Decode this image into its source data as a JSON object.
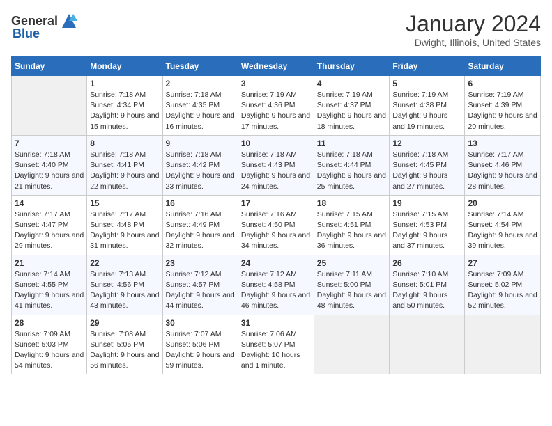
{
  "header": {
    "logo_general": "General",
    "logo_blue": "Blue",
    "title": "January 2024",
    "subtitle": "Dwight, Illinois, United States"
  },
  "days_of_week": [
    "Sunday",
    "Monday",
    "Tuesday",
    "Wednesday",
    "Thursday",
    "Friday",
    "Saturday"
  ],
  "weeks": [
    [
      {
        "day": "",
        "sunrise": "",
        "sunset": "",
        "daylight": ""
      },
      {
        "day": "1",
        "sunrise": "Sunrise: 7:18 AM",
        "sunset": "Sunset: 4:34 PM",
        "daylight": "Daylight: 9 hours and 15 minutes."
      },
      {
        "day": "2",
        "sunrise": "Sunrise: 7:18 AM",
        "sunset": "Sunset: 4:35 PM",
        "daylight": "Daylight: 9 hours and 16 minutes."
      },
      {
        "day": "3",
        "sunrise": "Sunrise: 7:19 AM",
        "sunset": "Sunset: 4:36 PM",
        "daylight": "Daylight: 9 hours and 17 minutes."
      },
      {
        "day": "4",
        "sunrise": "Sunrise: 7:19 AM",
        "sunset": "Sunset: 4:37 PM",
        "daylight": "Daylight: 9 hours and 18 minutes."
      },
      {
        "day": "5",
        "sunrise": "Sunrise: 7:19 AM",
        "sunset": "Sunset: 4:38 PM",
        "daylight": "Daylight: 9 hours and 19 minutes."
      },
      {
        "day": "6",
        "sunrise": "Sunrise: 7:19 AM",
        "sunset": "Sunset: 4:39 PM",
        "daylight": "Daylight: 9 hours and 20 minutes."
      }
    ],
    [
      {
        "day": "7",
        "sunrise": "Sunrise: 7:18 AM",
        "sunset": "Sunset: 4:40 PM",
        "daylight": "Daylight: 9 hours and 21 minutes."
      },
      {
        "day": "8",
        "sunrise": "Sunrise: 7:18 AM",
        "sunset": "Sunset: 4:41 PM",
        "daylight": "Daylight: 9 hours and 22 minutes."
      },
      {
        "day": "9",
        "sunrise": "Sunrise: 7:18 AM",
        "sunset": "Sunset: 4:42 PM",
        "daylight": "Daylight: 9 hours and 23 minutes."
      },
      {
        "day": "10",
        "sunrise": "Sunrise: 7:18 AM",
        "sunset": "Sunset: 4:43 PM",
        "daylight": "Daylight: 9 hours and 24 minutes."
      },
      {
        "day": "11",
        "sunrise": "Sunrise: 7:18 AM",
        "sunset": "Sunset: 4:44 PM",
        "daylight": "Daylight: 9 hours and 25 minutes."
      },
      {
        "day": "12",
        "sunrise": "Sunrise: 7:18 AM",
        "sunset": "Sunset: 4:45 PM",
        "daylight": "Daylight: 9 hours and 27 minutes."
      },
      {
        "day": "13",
        "sunrise": "Sunrise: 7:17 AM",
        "sunset": "Sunset: 4:46 PM",
        "daylight": "Daylight: 9 hours and 28 minutes."
      }
    ],
    [
      {
        "day": "14",
        "sunrise": "Sunrise: 7:17 AM",
        "sunset": "Sunset: 4:47 PM",
        "daylight": "Daylight: 9 hours and 29 minutes."
      },
      {
        "day": "15",
        "sunrise": "Sunrise: 7:17 AM",
        "sunset": "Sunset: 4:48 PM",
        "daylight": "Daylight: 9 hours and 31 minutes."
      },
      {
        "day": "16",
        "sunrise": "Sunrise: 7:16 AM",
        "sunset": "Sunset: 4:49 PM",
        "daylight": "Daylight: 9 hours and 32 minutes."
      },
      {
        "day": "17",
        "sunrise": "Sunrise: 7:16 AM",
        "sunset": "Sunset: 4:50 PM",
        "daylight": "Daylight: 9 hours and 34 minutes."
      },
      {
        "day": "18",
        "sunrise": "Sunrise: 7:15 AM",
        "sunset": "Sunset: 4:51 PM",
        "daylight": "Daylight: 9 hours and 36 minutes."
      },
      {
        "day": "19",
        "sunrise": "Sunrise: 7:15 AM",
        "sunset": "Sunset: 4:53 PM",
        "daylight": "Daylight: 9 hours and 37 minutes."
      },
      {
        "day": "20",
        "sunrise": "Sunrise: 7:14 AM",
        "sunset": "Sunset: 4:54 PM",
        "daylight": "Daylight: 9 hours and 39 minutes."
      }
    ],
    [
      {
        "day": "21",
        "sunrise": "Sunrise: 7:14 AM",
        "sunset": "Sunset: 4:55 PM",
        "daylight": "Daylight: 9 hours and 41 minutes."
      },
      {
        "day": "22",
        "sunrise": "Sunrise: 7:13 AM",
        "sunset": "Sunset: 4:56 PM",
        "daylight": "Daylight: 9 hours and 43 minutes."
      },
      {
        "day": "23",
        "sunrise": "Sunrise: 7:12 AM",
        "sunset": "Sunset: 4:57 PM",
        "daylight": "Daylight: 9 hours and 44 minutes."
      },
      {
        "day": "24",
        "sunrise": "Sunrise: 7:12 AM",
        "sunset": "Sunset: 4:58 PM",
        "daylight": "Daylight: 9 hours and 46 minutes."
      },
      {
        "day": "25",
        "sunrise": "Sunrise: 7:11 AM",
        "sunset": "Sunset: 5:00 PM",
        "daylight": "Daylight: 9 hours and 48 minutes."
      },
      {
        "day": "26",
        "sunrise": "Sunrise: 7:10 AM",
        "sunset": "Sunset: 5:01 PM",
        "daylight": "Daylight: 9 hours and 50 minutes."
      },
      {
        "day": "27",
        "sunrise": "Sunrise: 7:09 AM",
        "sunset": "Sunset: 5:02 PM",
        "daylight": "Daylight: 9 hours and 52 minutes."
      }
    ],
    [
      {
        "day": "28",
        "sunrise": "Sunrise: 7:09 AM",
        "sunset": "Sunset: 5:03 PM",
        "daylight": "Daylight: 9 hours and 54 minutes."
      },
      {
        "day": "29",
        "sunrise": "Sunrise: 7:08 AM",
        "sunset": "Sunset: 5:05 PM",
        "daylight": "Daylight: 9 hours and 56 minutes."
      },
      {
        "day": "30",
        "sunrise": "Sunrise: 7:07 AM",
        "sunset": "Sunset: 5:06 PM",
        "daylight": "Daylight: 9 hours and 59 minutes."
      },
      {
        "day": "31",
        "sunrise": "Sunrise: 7:06 AM",
        "sunset": "Sunset: 5:07 PM",
        "daylight": "Daylight: 10 hours and 1 minute."
      },
      {
        "day": "",
        "sunrise": "",
        "sunset": "",
        "daylight": ""
      },
      {
        "day": "",
        "sunrise": "",
        "sunset": "",
        "daylight": ""
      },
      {
        "day": "",
        "sunrise": "",
        "sunset": "",
        "daylight": ""
      }
    ]
  ]
}
